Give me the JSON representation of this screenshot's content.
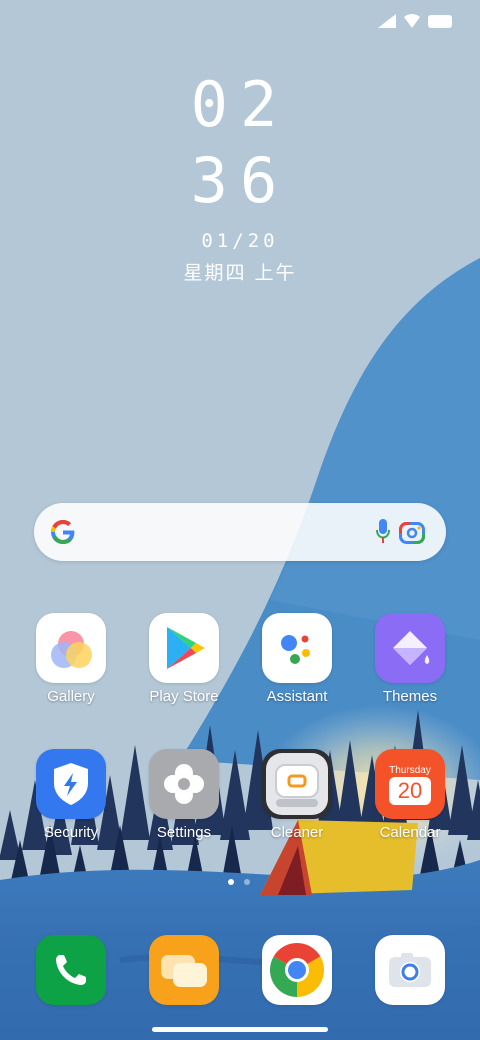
{
  "status_bar": {
    "icons": [
      "signal-icon",
      "wifi-icon",
      "battery-icon"
    ]
  },
  "clock": {
    "hour": "02",
    "minute": "36",
    "date": "01/20",
    "weekday": "星期四 上午"
  },
  "search_bar": {
    "icons": [
      "google-g-icon",
      "microphone-icon",
      "google-lens-icon"
    ]
  },
  "apps": [
    {
      "label": "Gallery",
      "icon": "gallery-icon"
    },
    {
      "label": "Play Store",
      "icon": "play-store-icon"
    },
    {
      "label": "Assistant",
      "icon": "assistant-icon"
    },
    {
      "label": "Themes",
      "icon": "themes-icon"
    },
    {
      "label": "Security",
      "icon": "security-icon"
    },
    {
      "label": "Settings",
      "icon": "settings-icon"
    },
    {
      "label": "Cleaner",
      "icon": "cleaner-icon"
    },
    {
      "label": "Calendar",
      "icon": "calendar-icon",
      "month_text": "Thursday",
      "day_number": "20"
    }
  ],
  "page_indicator": {
    "pages": 2,
    "current": 1
  },
  "dock": [
    {
      "icon": "phone-icon"
    },
    {
      "icon": "messages-icon"
    },
    {
      "icon": "chrome-icon"
    },
    {
      "icon": "camera-icon"
    }
  ],
  "colors": {
    "sky": "#b3c7d7",
    "wave": "#4a8cc6",
    "ground": "#3a74b6",
    "tent": "#e6be2c"
  }
}
